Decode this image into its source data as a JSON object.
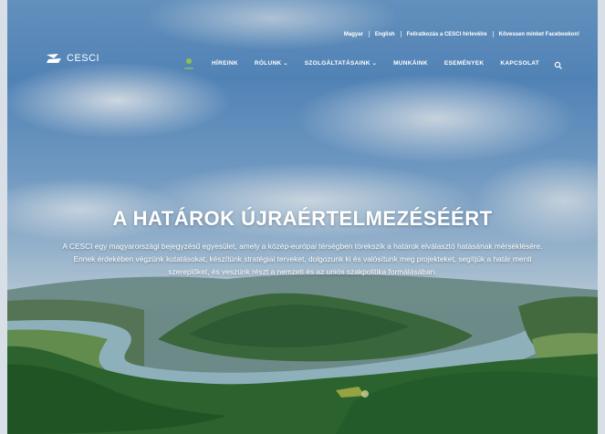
{
  "top_links": [
    "Magyar",
    "English",
    "Feliratkozás a CESCI hírlevélre",
    "Kövessen minket Facebookon!"
  ],
  "logo": {
    "text": "CESCI"
  },
  "nav": {
    "items": [
      {
        "label": "HÍREINK",
        "has_dropdown": false
      },
      {
        "label": "RÓLUNK",
        "has_dropdown": true
      },
      {
        "label": "SZOLGÁLTATÁSAINK",
        "has_dropdown": true
      },
      {
        "label": "MUNKÁINK",
        "has_dropdown": false
      },
      {
        "label": "ESEMÉNYEK",
        "has_dropdown": false
      },
      {
        "label": "KAPCSOLAT",
        "has_dropdown": false
      }
    ],
    "chevron": "⌄",
    "home_icon": "home-icon",
    "search_icon": "search-icon"
  },
  "hero": {
    "headline": "A HATÁROK ÚJRAÉRTELMEZÉSÉÉRT",
    "text": "A CESCI egy magyarországi bejegyzésű egyesület, amely a közép-európai térségben törekszik a határok elválasztó hatásának mérséklésére. Ennek érdekében végzünk kutatásokat, készítünk stratégiai terveket, dolgozunk ki és valósítunk meg projekteket, segítjük a határ menti szereplőket, és veszünk részt a nemzeti és az uniós szakpolitika formálásában."
  },
  "colors": {
    "accent": "#8bc34a",
    "text": "#ffffff",
    "sky": "#5a8fc7",
    "forest": "#2f6a2c",
    "river": "#8fb9c4"
  }
}
